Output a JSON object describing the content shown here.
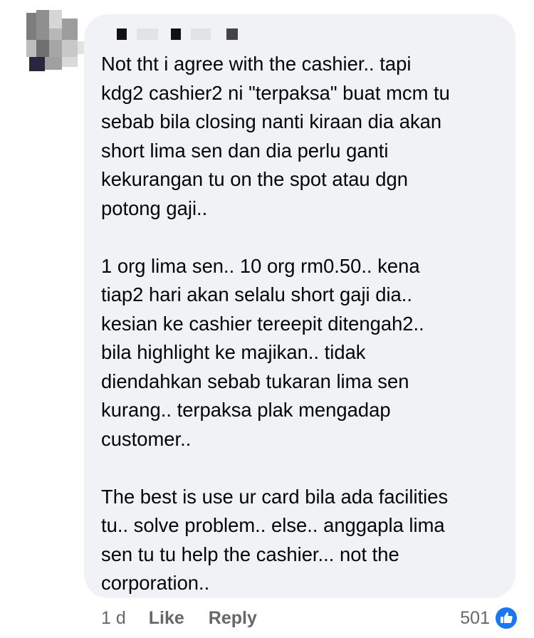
{
  "comment": {
    "author": "",
    "paragraphs": [
      "Not tht i agree with the cashier.. tapi\nkdg2 cashier2 ni \"terpaksa\" buat mcm tu\nsebab bila closing nanti kiraan dia akan\nshort lima sen dan dia perlu ganti\nkekurangan tu on the spot atau dgn\npotong gaji..",
      "1 org lima sen.. 10 org rm0.50.. kena\ntiap2 hari akan selalu short gaji dia..\nkesian ke cashier tereepit ditengah2..\nbila highlight ke majikan.. tidak\ndiendahkan sebab tukaran lima sen\nkurang.. terpaksa plak mengadap\ncustomer..",
      "The best is use ur card bila ada facilities\ntu.. solve problem.. else.. anggapla lima\nsen tu tu help the cashier... not the\ncorporation.."
    ],
    "timestamp": "1 d",
    "like_label": "Like",
    "reply_label": "Reply",
    "reaction_count": "501"
  },
  "icons": {
    "reaction": "thumbs-up-like-icon"
  },
  "colors": {
    "bubble_bg": "#f0f2f5",
    "text": "#050505",
    "meta_text": "#65676b",
    "like_blue": "#1877f2"
  }
}
